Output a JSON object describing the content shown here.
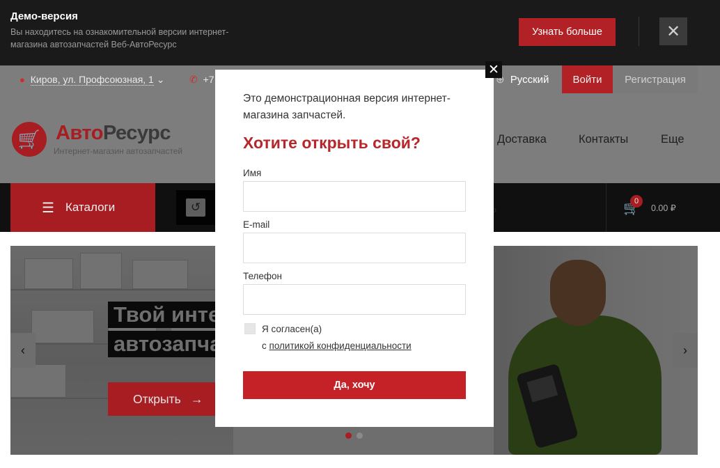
{
  "demo": {
    "title": "Демо-версия",
    "text": "Вы находитесь на ознакомительной версии интернет-магазина автозапчастей Веб-АвтоРесурс",
    "more_button": "Узнать больше",
    "close_glyph": "✕"
  },
  "topbar": {
    "location": "Киров, ул. Профсоюзная, 1",
    "location_pin_glyph": "●",
    "location_chevron": "⌄",
    "phone": "+7",
    "phone_glyph": "✆",
    "language": "Русский",
    "language_glyph": "⊕",
    "login": "Войти",
    "register": "Регистрация"
  },
  "header": {
    "logo_a": "Авто",
    "logo_b": "Ресурс",
    "logo_sub": "Интернет-магазин автозапчастей",
    "logo_glyph": "🛒",
    "nav": [
      "Доставка",
      "Контакты",
      "Еще"
    ]
  },
  "navstrip": {
    "catalog_label": "Каталоги",
    "catalog_glyph": "☰",
    "history_glyph": "↺",
    "search_glyph": "⌕",
    "cart_glyph": "🛒",
    "cart_count": "0",
    "cart_total": "0.00 ₽"
  },
  "hero": {
    "title_line1": "Твой инте",
    "title_line2": "автозапча",
    "open_button": "Открыть",
    "open_arrow": "→",
    "prev_glyph": "‹",
    "next_glyph": "›"
  },
  "modal": {
    "close_glyph": "✕",
    "intro": "Это демонстрационная версия интернет-магазина запчастей.",
    "heading": "Хотите открыть свой?",
    "name_label": "Имя",
    "name_value": "",
    "email_label": "E-mail",
    "email_value": "",
    "phone_label": "Телефон",
    "phone_value": "",
    "agree_text": "Я согласен(а)",
    "agree_prefix": "с",
    "agree_link": "политикой конфиденциальности",
    "submit": "Да, хочу"
  },
  "colors": {
    "accent_red": "#c42226",
    "dark": "#1a1a1a"
  }
}
